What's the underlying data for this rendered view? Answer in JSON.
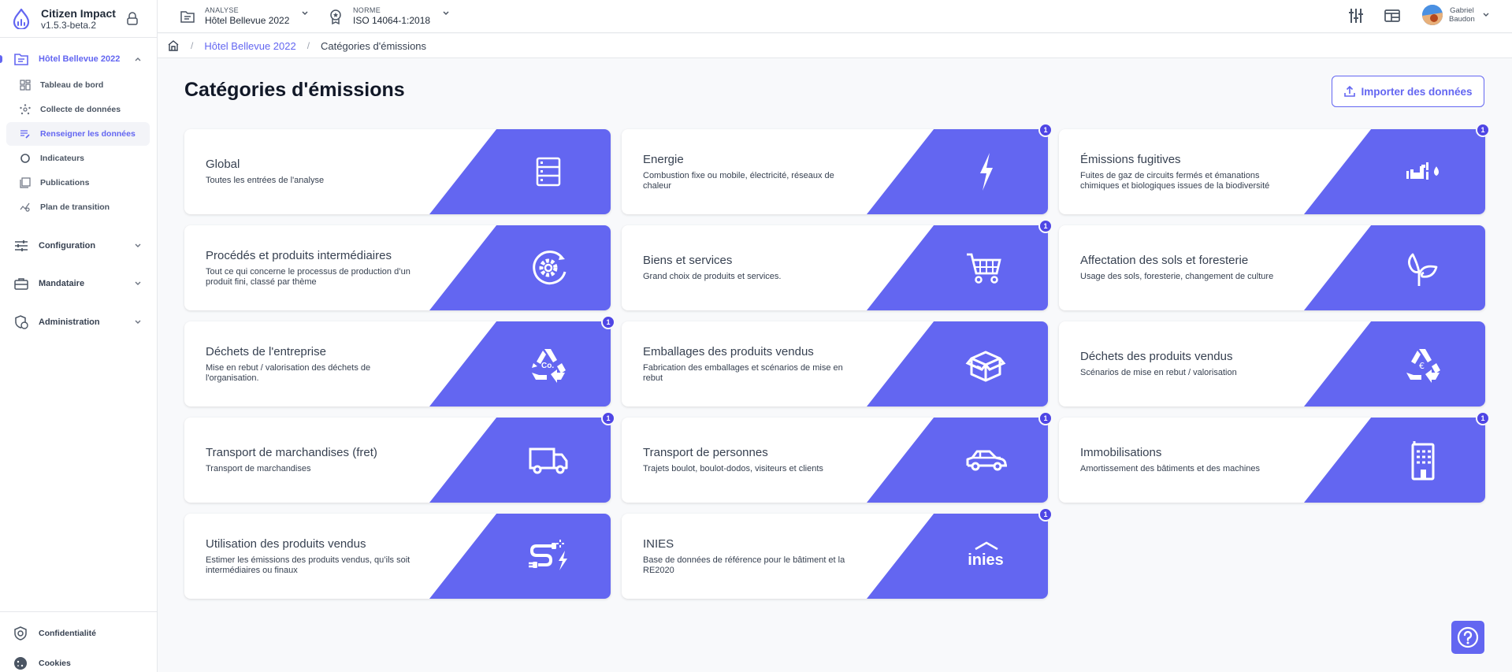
{
  "app": {
    "name": "Citizen Impact",
    "version": "v1.5.3-beta.2"
  },
  "sidebar": {
    "project": {
      "label": "Hôtel Bellevue 2022",
      "icon": "folder-icon",
      "expanded": true
    },
    "sub_items": [
      {
        "label": "Tableau de bord",
        "icon": "dashboard-icon",
        "active": false
      },
      {
        "label": "Collecte de données",
        "icon": "network-icon",
        "active": false
      },
      {
        "label": "Renseigner les données",
        "icon": "edit-list-icon",
        "active": true
      },
      {
        "label": "Indicateurs",
        "icon": "ring-chart-icon",
        "active": false
      },
      {
        "label": "Publications",
        "icon": "publication-icon",
        "active": false
      },
      {
        "label": "Plan de transition",
        "icon": "trend-search-icon",
        "active": false
      }
    ],
    "sections": [
      {
        "label": "Configuration",
        "icon": "sliders-icon"
      },
      {
        "label": "Mandataire",
        "icon": "briefcase-icon"
      },
      {
        "label": "Administration",
        "icon": "shield-user-icon"
      }
    ],
    "bottom": [
      {
        "label": "Confidentialité",
        "icon": "privacy-shield-icon"
      },
      {
        "label": "Cookies",
        "icon": "cookie-icon"
      }
    ]
  },
  "topbar": {
    "analyse": {
      "caption": "ANALYSE",
      "value": "Hôtel Bellevue 2022"
    },
    "norme": {
      "caption": "NORME",
      "value": "ISO 14064-1:2018"
    },
    "user": {
      "first_name": "Gabriel",
      "last_name": "Baudon"
    }
  },
  "breadcrumb": {
    "items": [
      "Hôtel Bellevue 2022",
      "Catégories d'émissions"
    ]
  },
  "main": {
    "title": "Catégories d'émissions",
    "import_label": "Importer des données",
    "accent": "#6366f1",
    "cards": [
      {
        "title": "Global",
        "desc": "Toutes les entrées de l'analyse",
        "icon": "database-icon",
        "badge": null
      },
      {
        "title": "Energie",
        "desc": "Combustion fixe ou mobile, électricité, réseaux de chaleur",
        "icon": "lightning-icon",
        "badge": "1"
      },
      {
        "title": "Émissions fugitives",
        "desc": "Fuites de gaz de circuits fermés et émanations chimiques et biologiques issues de la biodiversité",
        "icon": "pipe-leak-icon",
        "badge": "1"
      },
      {
        "title": "Procédés et produits intermédiaires",
        "desc": "Tout ce qui concerne le processus de production d’un produit fini, classé par thème",
        "icon": "gear-cycle-icon",
        "badge": null
      },
      {
        "title": "Biens et services",
        "desc": "Grand choix de produits et services.",
        "icon": "cart-icon",
        "badge": "1"
      },
      {
        "title": "Affectation des sols et foresterie",
        "desc": "Usage des sols, foresterie, changement de culture",
        "icon": "sprout-icon",
        "badge": null
      },
      {
        "title": "Déchets de l'entreprise",
        "desc": "Mise en rebut / valorisation des déchets de l'organisation.",
        "icon": "recycle-co-icon",
        "badge": "1"
      },
      {
        "title": "Emballages des produits vendus",
        "desc": "Fabrication des emballages et scénarios de mise en rebut",
        "icon": "box-icon",
        "badge": null
      },
      {
        "title": "Déchets des produits vendus",
        "desc": "Scénarios de mise en rebut / valorisation",
        "icon": "recycle-euro-icon",
        "badge": null
      },
      {
        "title": "Transport de marchandises (fret)",
        "desc": "Transport de marchandises",
        "icon": "truck-icon",
        "badge": "1"
      },
      {
        "title": "Transport de personnes",
        "desc": "Trajets boulot, boulot-dodos, visiteurs et clients",
        "icon": "car-icon",
        "badge": "1"
      },
      {
        "title": "Immobilisations",
        "desc": "Amortissement des bâtiments et des machines",
        "icon": "building-icon",
        "badge": "1"
      },
      {
        "title": "Utilisation des produits vendus",
        "desc": "Estimer les émissions des produits vendus, qu’ils soit intermédiaires ou finaux",
        "icon": "plug-energy-icon",
        "badge": null
      },
      {
        "title": "INIES",
        "desc": "Base de données de référence pour le bâtiment et la RE2020",
        "icon": "inies-logo-icon",
        "icon_text": "inies",
        "badge": "1"
      }
    ]
  },
  "help": {
    "icon": "help-icon"
  }
}
